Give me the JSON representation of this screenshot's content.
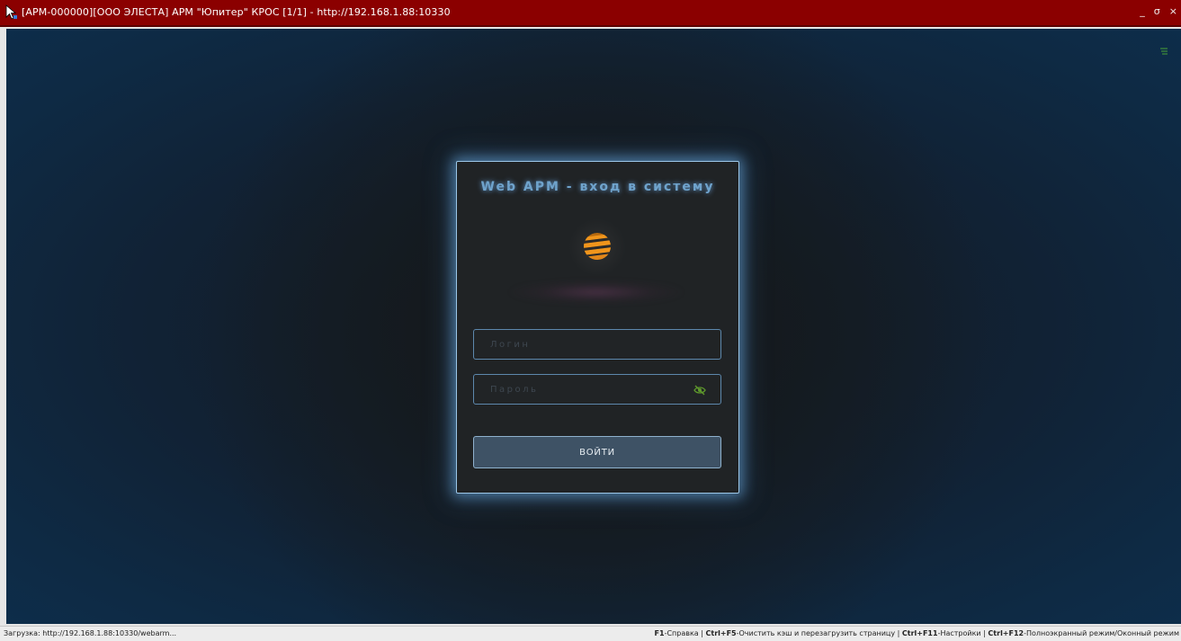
{
  "window": {
    "title": "[АРМ-000000][ООО ЭЛЕСТА] АРМ \"Юпитер\" КРОС [1/1] - http://192.168.1.88:10330",
    "minimize_label": "_",
    "maximize_label": "σ",
    "close_label": "×",
    "title_bar_color": "#8b0000"
  },
  "login": {
    "title": "Web АРМ - вход в систему",
    "login_placeholder": "Логин",
    "password_placeholder": "Пароль",
    "submit_label": "ВОЙТИ",
    "logo_icon": "sphere-stripes-icon",
    "eye_icon": "eye-slash-icon",
    "accent_color": "#6fa3cc",
    "logo_color": "#e08a16"
  },
  "statusbar": {
    "loading_text": "Загрузка: http://192.168.1.88:10330/webarm...",
    "shortcuts": [
      {
        "key": "F1",
        "label": "-Справка"
      },
      {
        "key": "Ctrl+F5",
        "label": "-Очистить кэш и перезагрузить страницу"
      },
      {
        "key": "Ctrl+F11",
        "label": "-Настройки"
      },
      {
        "key": "Ctrl+F12",
        "label": "-Полноэкранный режим/Оконный режим"
      }
    ],
    "separator": " | "
  }
}
